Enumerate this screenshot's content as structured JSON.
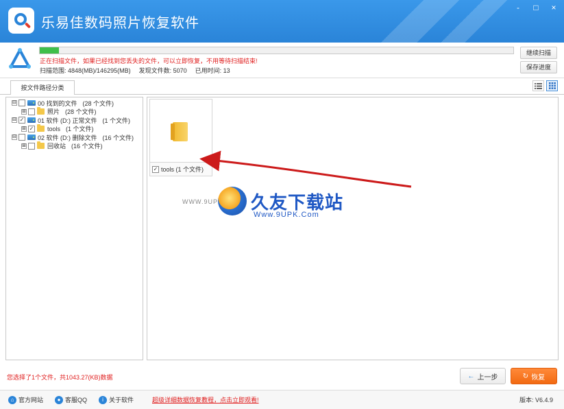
{
  "window": {
    "title": "乐易佳数码照片恢复软件",
    "controls": [
      "-",
      "□",
      "×"
    ]
  },
  "scan": {
    "progress_fraction": 0.04,
    "message": "正在扫描文件，如果已经找到您丢失的文件，可以立即恢复，不用等待扫描结束!",
    "range_label": "扫描范围:",
    "range_value": "4848(MB)/146295(MB)",
    "found_label": "发现文件数:",
    "found_value": "5070",
    "time_label": "已用时间:",
    "time_value": "13",
    "continue_button": "继续扫描",
    "save_button": "保存进度"
  },
  "tabs": {
    "active": "按文件路径分类"
  },
  "tree": [
    {
      "level": 0,
      "expander": "⊟",
      "checked": false,
      "icon": "drive",
      "label": "00 找到的文件",
      "count": "(28 个文件)"
    },
    {
      "level": 1,
      "expander": "⊞",
      "checked": false,
      "icon": "folder",
      "label": "照片",
      "count": "(28 个文件)"
    },
    {
      "level": 0,
      "expander": "⊟",
      "checked": true,
      "icon": "drive",
      "label": "01 软件 (D:) 正常文件",
      "count": "(1 个文件)"
    },
    {
      "level": 1,
      "expander": "⊞",
      "checked": true,
      "icon": "folder",
      "label": "tools",
      "count": "(1 个文件)"
    },
    {
      "level": 0,
      "expander": "⊟",
      "checked": false,
      "icon": "drive",
      "label": "02 软件 (D:) 删除文件",
      "count": "(16 个文件)"
    },
    {
      "level": 1,
      "expander": "⊞",
      "checked": false,
      "icon": "folder",
      "label": "回收站",
      "count": "(16 个文件)"
    }
  ],
  "content": {
    "thumbnail_label": "tools (1 个文件)",
    "thumbnail_checked": true
  },
  "watermark": {
    "title": "久友下载站",
    "url": "Www.9UPK.Com",
    "left_url": "WWW.9UPK.COM"
  },
  "bottom": {
    "selection_info": "您选择了1个文件，共1043.27(KB)数据",
    "prev_button": "上一步",
    "recover_button": "恢复"
  },
  "footer": {
    "official_site": "官方网站",
    "support_qq": "客服QQ",
    "about": "关于软件",
    "promo": "超级详细数据恢复教程，点击立即观看!",
    "version": "版本: V6.4.9"
  },
  "colors": {
    "title_bar": "#2a84d8",
    "progress_fill": "#3fbf4a",
    "warning_text": "#e02020",
    "recover_button": "#f26a12",
    "arrow": "#cc1a1a"
  }
}
